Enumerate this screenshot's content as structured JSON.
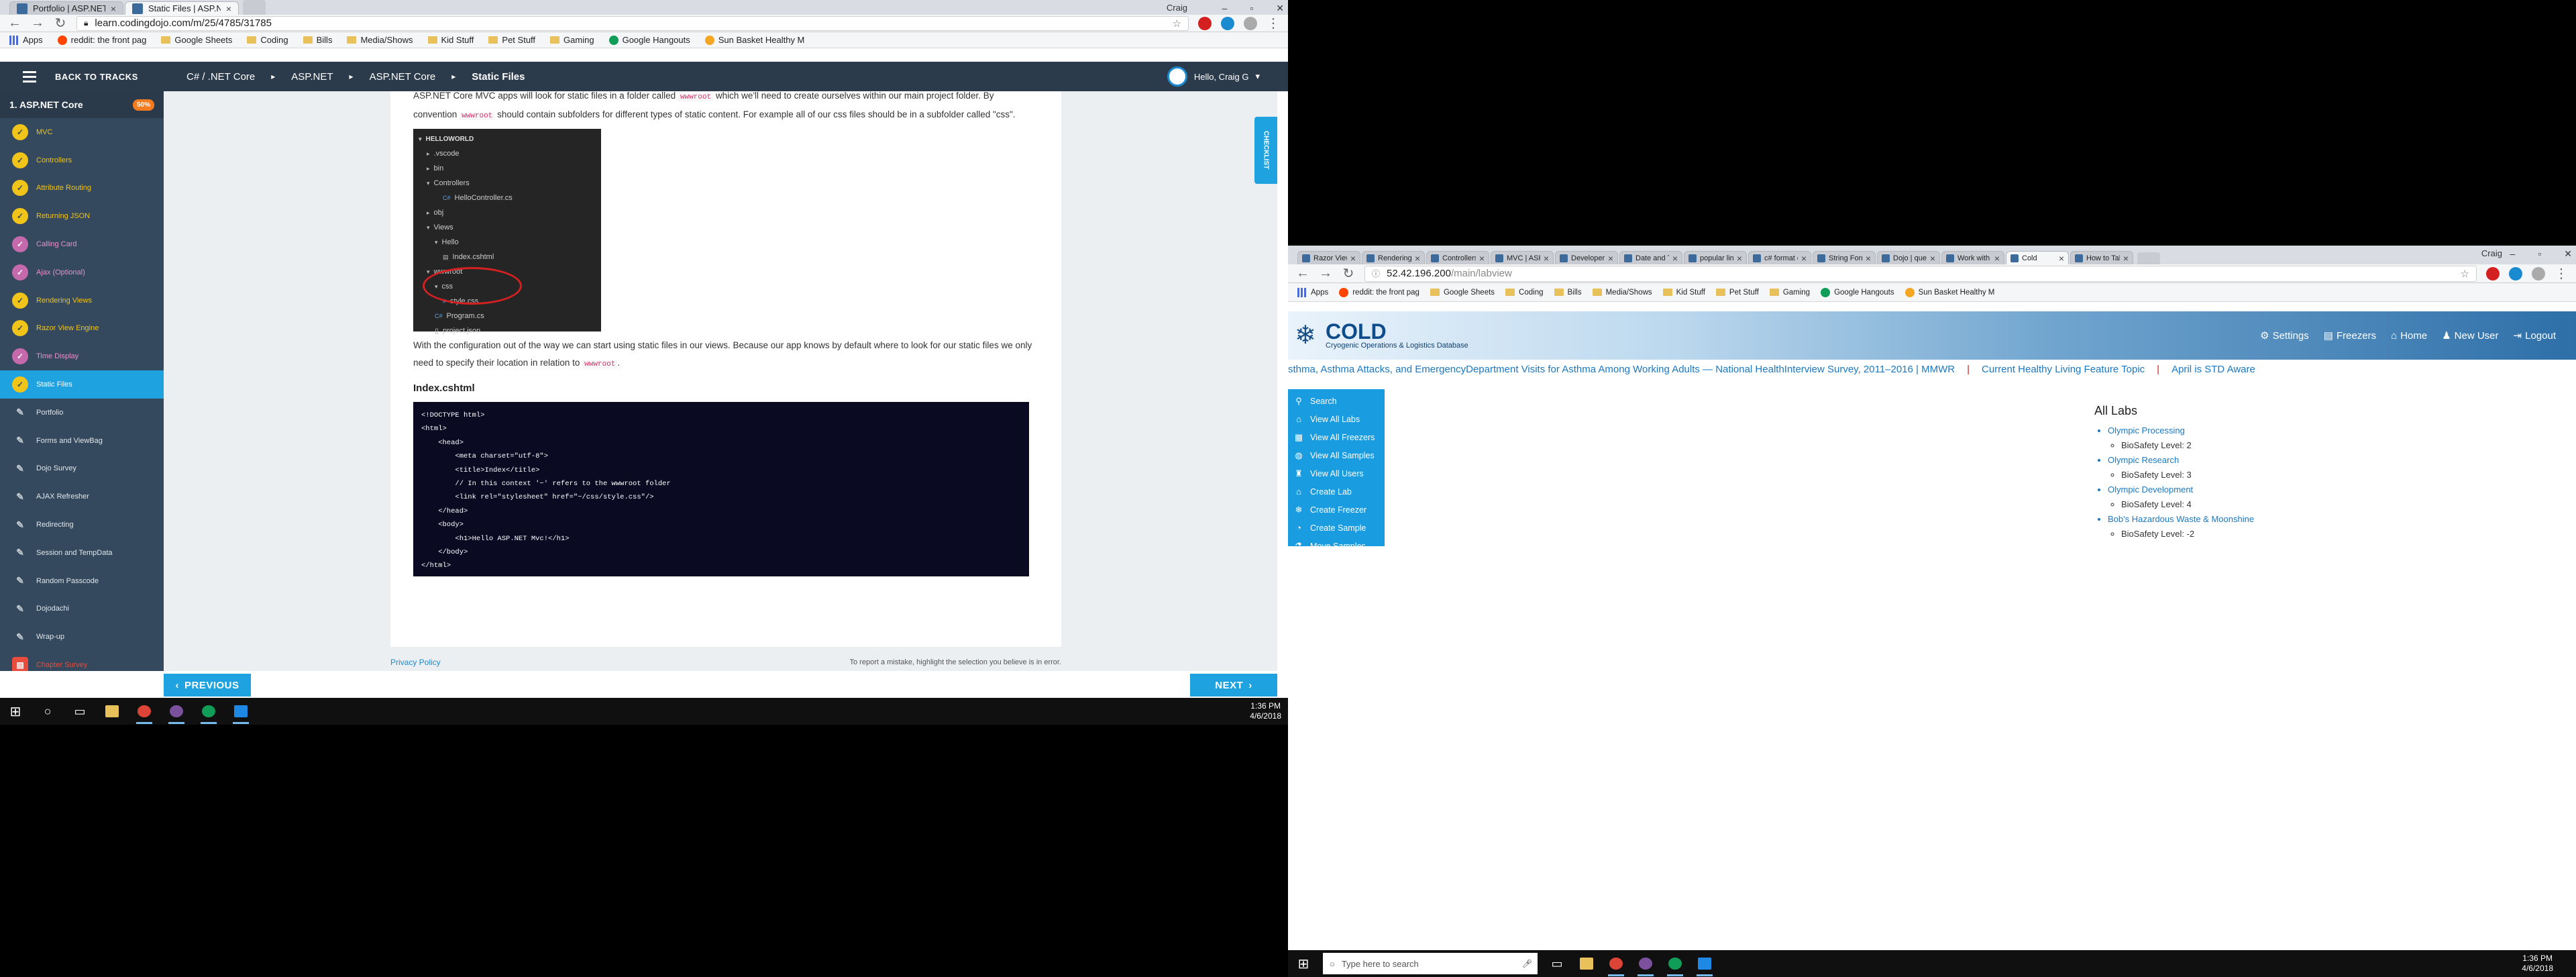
{
  "left": {
    "tabs": [
      {
        "label": "Portfolio | ASP.NET Core",
        "active": false
      },
      {
        "label": "Static Files | ASP.NET Co",
        "active": true
      }
    ],
    "user_name": "Craig",
    "url": "learn.codingdojo.com/m/25/4785/31785",
    "bookmarks": [
      "Apps",
      "reddit: the front pag",
      "Google Sheets",
      "Coding",
      "Bills",
      "Media/Shows",
      "Kid Stuff",
      "Pet Stuff",
      "Gaming",
      "Google Hangouts",
      "Sun Basket Healthy M"
    ],
    "topbar": {
      "back_label": "BACK TO TRACKS",
      "crumbs": [
        "C# / .NET Core",
        "ASP.NET",
        "ASP.NET Core",
        "Static Files"
      ],
      "user": "Hello, Craig G"
    },
    "sidebar": {
      "title": "1. ASP.NET Core",
      "progress": "50%",
      "items": [
        {
          "label": "MVC",
          "style": "yellow"
        },
        {
          "label": "Controllers",
          "style": "yellow"
        },
        {
          "label": "Attribute Routing",
          "style": "yellow"
        },
        {
          "label": "Returning JSON",
          "style": "yellow"
        },
        {
          "label": "Calling Card",
          "style": "pink"
        },
        {
          "label": "Ajax (Optional)",
          "style": "pink"
        },
        {
          "label": "Rendering Views",
          "style": "yellow"
        },
        {
          "label": "Razor View Engine",
          "style": "yellow"
        },
        {
          "label": "Time Display",
          "style": "pink"
        },
        {
          "label": "Static Files",
          "style": "active"
        },
        {
          "label": "Portfolio",
          "style": "grey"
        },
        {
          "label": "Forms and ViewBag",
          "style": "grey"
        },
        {
          "label": "Dojo Survey",
          "style": "grey"
        },
        {
          "label": "AJAX Refresher",
          "style": "grey"
        },
        {
          "label": "Redirecting",
          "style": "grey"
        },
        {
          "label": "Session and TempData",
          "style": "grey"
        },
        {
          "label": "Random Passcode",
          "style": "grey"
        },
        {
          "label": "Dojodachi",
          "style": "grey"
        },
        {
          "label": "Wrap-up",
          "style": "grey"
        },
        {
          "label": "Chapter Survey",
          "style": "red"
        }
      ]
    },
    "content": {
      "para1_a": "ASP.NET Core MVC apps will look for static files in a folder called",
      "para1_code1": "wwwroot",
      "para1_b": "which we'll need to create ourselves within our main project folder. By convention",
      "para1_code2": "wwwroot",
      "para1_c": "should contain subfolders for different types of static content. For example all of our css files should be in a subfolder called \"css\".",
      "tree": [
        {
          "label": "HELLOWORLD",
          "indent": 0,
          "prefix": "▾",
          "hd": true
        },
        {
          "label": ".vscode",
          "indent": 1,
          "prefix": "▸"
        },
        {
          "label": "bin",
          "indent": 1,
          "prefix": "▸"
        },
        {
          "label": "Controllers",
          "indent": 1,
          "prefix": "▾"
        },
        {
          "label": "HelloController.cs",
          "indent": 3,
          "prefix": "C#"
        },
        {
          "label": "obj",
          "indent": 1,
          "prefix": "▸"
        },
        {
          "label": "Views",
          "indent": 1,
          "prefix": "▾"
        },
        {
          "label": "Hello",
          "indent": 2,
          "prefix": "▾"
        },
        {
          "label": "Index.cshtml",
          "indent": 3,
          "prefix": "▤"
        },
        {
          "label": "wwwroot",
          "indent": 1,
          "prefix": "▾"
        },
        {
          "label": "css",
          "indent": 2,
          "prefix": "▾"
        },
        {
          "label": "style.css",
          "indent": 3,
          "prefix": "#"
        },
        {
          "label": "Program.cs",
          "indent": 2,
          "prefix": "C#"
        },
        {
          "label": "project.json",
          "indent": 2,
          "prefix": "{}"
        }
      ],
      "para2_a": "With the configuration out of the way we can start using static files in our views. Because our app knows by default where to look for our static files we only need to specify their location in relation to",
      "para2_code": "wwwroot",
      "para2_b": ".",
      "heading": "Index.cshtml",
      "code_lines": [
        "<!DOCTYPE html>",
        "<html>",
        "    <head>",
        "        <meta charset=\"utf-8\">",
        "        <title>Index</title>",
        "        // In this context '~' refers to the wwwroot folder",
        "        <link rel=\"stylesheet\" href=\"~/css/style.css\"/>",
        "    </head>",
        "    <body>",
        "        <h1>Hello ASP.NET Mvc!</h1>",
        "    </body>",
        "</html>"
      ],
      "privacy": "Privacy Policy",
      "report": "To report a mistake, highlight the selection you believe is in error.",
      "checklist": "CHECKLIST"
    },
    "nav": {
      "previous": "PREVIOUS",
      "next": "NEXT"
    },
    "clock": {
      "time": "1:36 PM",
      "date": "4/6/2018"
    }
  },
  "right": {
    "tabs": [
      "Razor View E",
      "Rendering V",
      "Controllers",
      "MVC | ASP",
      "Developer T",
      "Date and Tim",
      "popular links",
      "c# format da",
      "String Form",
      "Dojo | quest",
      "Work with c",
      "Cold",
      "How to Take"
    ],
    "active_tab": 11,
    "user_name": "Craig",
    "url_host": "52.42.196.200",
    "url_path": "/main/labview",
    "bookmarks": [
      "Apps",
      "reddit: the front pag",
      "Google Sheets",
      "Coding",
      "Bills",
      "Media/Shows",
      "Kid Stuff",
      "Pet Stuff",
      "Gaming",
      "Google Hangouts",
      "Sun Basket Healthy M"
    ],
    "logo": {
      "title": "COLD",
      "subtitle": "Cryogenic Operations & Logistics Database"
    },
    "nav": [
      "Settings",
      "Freezers",
      "Home",
      "New User",
      "Logout"
    ],
    "ticker": [
      "sthma, Asthma Attacks, and EmergencyDepartment Visits for Asthma Among Working Adults — National HealthInterview Survey, 2011–2016 | MMWR",
      "Current Healthy Living Feature Topic",
      "April is STD Aware"
    ],
    "menu": [
      {
        "label": "Search",
        "icon": "search-icon",
        "glyph": "⚲"
      },
      {
        "label": "View All Labs",
        "icon": "lab-icon",
        "glyph": "⌂"
      },
      {
        "label": "View All Freezers",
        "icon": "freezer-icon",
        "glyph": "▦"
      },
      {
        "label": "View All Samples",
        "icon": "sample-icon",
        "glyph": "◍"
      },
      {
        "label": "View All Users",
        "icon": "user-icon",
        "glyph": "♜"
      },
      {
        "label": "Create Lab",
        "icon": "create-lab-icon",
        "glyph": "⌂"
      },
      {
        "label": "Create Freezer",
        "icon": "create-freezer-icon",
        "glyph": "❄"
      },
      {
        "label": "Create Sample",
        "icon": "create-sample-icon",
        "glyph": "◔"
      },
      {
        "label": "Move Samples",
        "icon": "move-samples-icon",
        "glyph": "⚗"
      }
    ],
    "page_title": "All Labs",
    "labs": [
      {
        "name": "Olympic Processing",
        "level": "BioSafety Level: 2"
      },
      {
        "name": "Olympic Research",
        "level": "BioSafety Level: 3"
      },
      {
        "name": "Olympic Development",
        "level": "BioSafety Level: 4"
      },
      {
        "name": "Bob's Hazardous Waste & Moonshine",
        "level": "BioSafety Level: -2"
      }
    ],
    "search_placeholder": "Type here to search",
    "clock": {
      "time": "1:36 PM",
      "date": "4/6/2018"
    }
  },
  "colors": {
    "accent": "#1fa3e0",
    "sidebar": "#34495e",
    "topbar": "#2c3b4c",
    "cold_menu": "#1a9ce0",
    "link": "#1a78c2"
  }
}
